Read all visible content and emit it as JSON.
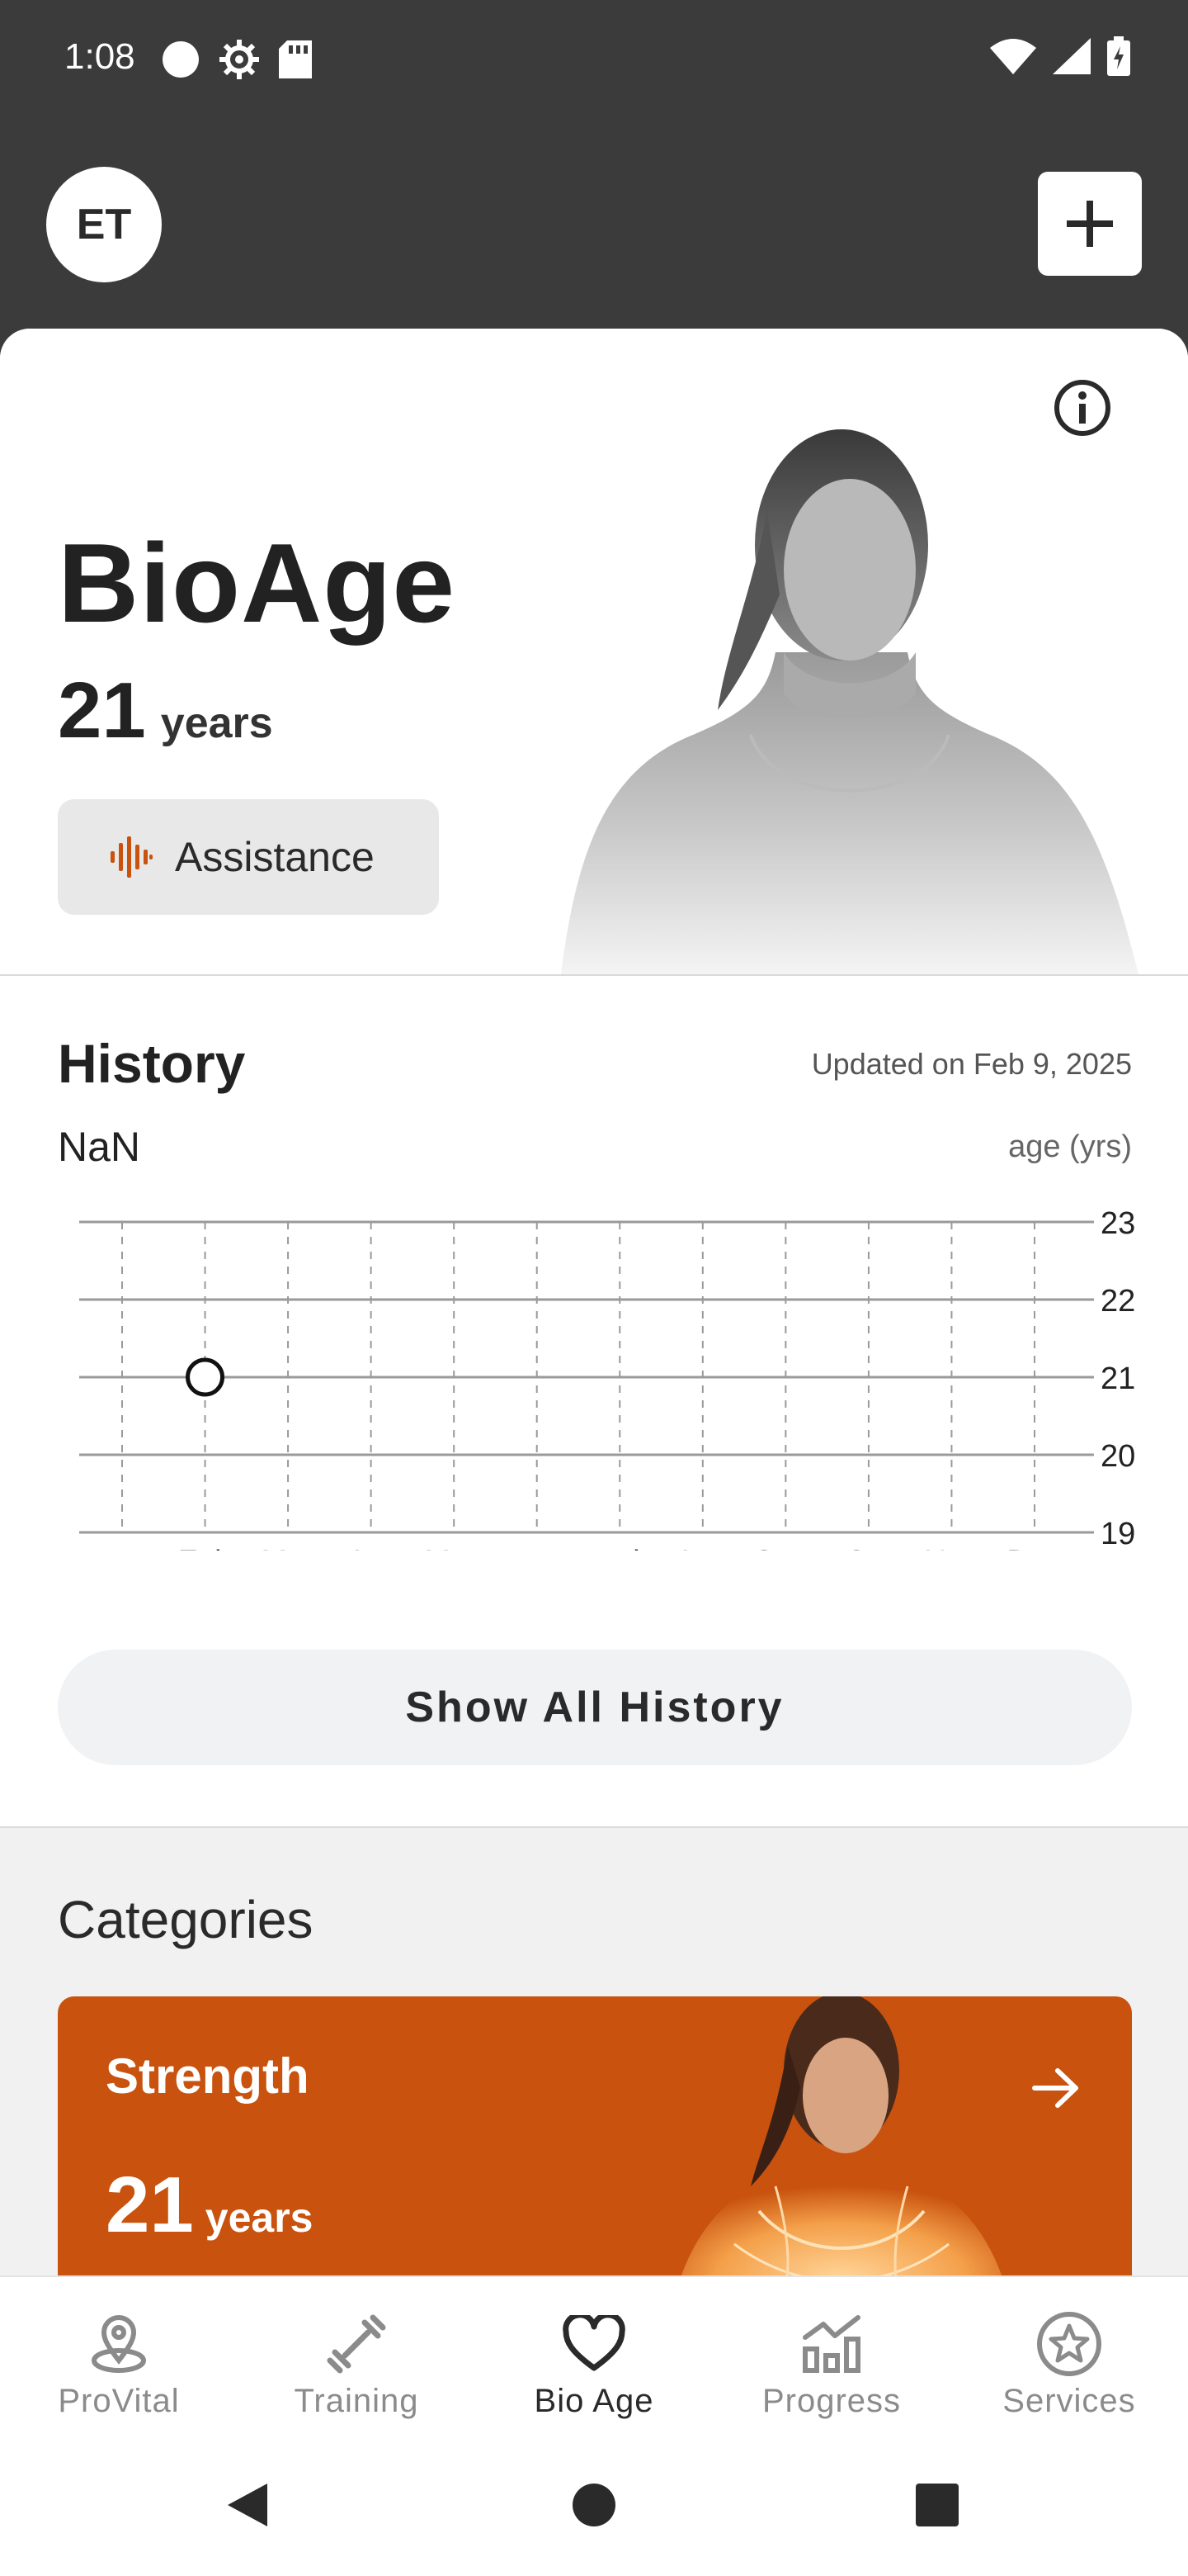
{
  "status_bar": {
    "time": "1:08",
    "left_icons": [
      "circle-notification-icon",
      "settings-gear-icon",
      "sd-card-icon"
    ],
    "right_icons": [
      "wifi-icon",
      "signal-icon",
      "battery-charging-icon"
    ]
  },
  "header": {
    "avatar_initials": "ET",
    "add_icon": "plus-icon"
  },
  "hero": {
    "title": "BioAge",
    "age_value": "21",
    "age_unit": "years",
    "assistance_label": "Assistance",
    "info_icon": "info-icon"
  },
  "history": {
    "title": "History",
    "updated": "Updated on Feb 9, 2025",
    "current_value": "NaN",
    "unit_label": "age (yrs)",
    "show_all_label": "Show All History"
  },
  "chart_data": {
    "type": "scatter",
    "categories": [
      "Jan",
      "Feb",
      "Mar",
      "Apr",
      "May",
      "Jun",
      "Jul",
      "Aug",
      "Sept",
      "Oct",
      "Nov",
      "Dec"
    ],
    "x": [
      "Feb"
    ],
    "y": [
      21
    ],
    "ylabel": "age (yrs)",
    "yticks": [
      19,
      20,
      21,
      22,
      23
    ],
    "ylim": [
      19,
      23
    ],
    "grid": true,
    "marker": "hollow-circle"
  },
  "categories_section": {
    "title": "Categories",
    "cards": [
      {
        "title": "Strength",
        "age_value": "21",
        "age_unit": "years",
        "arrow_icon": "arrow-right-icon"
      }
    ]
  },
  "bottom_nav": {
    "items": [
      {
        "label": "ProVital",
        "icon": "pin-user-icon",
        "active": false
      },
      {
        "label": "Training",
        "icon": "dumbbell-icon",
        "active": false
      },
      {
        "label": "Bio Age",
        "icon": "heart-icon",
        "active": true
      },
      {
        "label": "Progress",
        "icon": "bar-chart-trend-icon",
        "active": false
      },
      {
        "label": "Services",
        "icon": "star-badge-icon",
        "active": false
      }
    ]
  },
  "colors": {
    "accent": "#c8520e",
    "header_bg": "#3b3b3b",
    "sheet_bg": "#f1f1f2"
  }
}
